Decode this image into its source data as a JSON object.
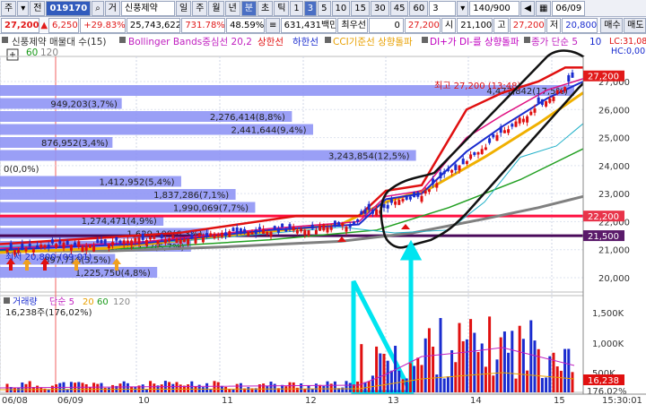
{
  "toolbar": {
    "code_label": "주",
    "market_label": "전",
    "code": "019170",
    "type_label": "거",
    "name": "신풍제약",
    "periods": [
      "일",
      "주",
      "월",
      "년",
      "분",
      "초",
      "틱"
    ],
    "active_period": "분",
    "intervals": [
      "1",
      "3",
      "5",
      "10",
      "15",
      "30",
      "45",
      "60"
    ],
    "active_interval": "1",
    "interval_value": "3",
    "count": "140/900",
    "date": "06/09"
  },
  "quote": {
    "price": "27,200",
    "change": "6,250",
    "change_pct": "+29.83%",
    "volume": "25,743,622",
    "turnover_pct": "731.78%",
    "ratio": "48.59%",
    "amount": "631,431백만",
    "best_quote_label": "최우선",
    "best_quote_value": "0",
    "current": "27,200",
    "open_label": "시",
    "open": "21,100",
    "high_label": "고",
    "high": "27,200",
    "low_label": "저",
    "low": "20,800",
    "buy_label": "매수",
    "sell_label": "매도"
  },
  "legend": {
    "title": "신풍제약 매물대 수(15)",
    "bollinger": "Bollinger Bands중심선 20,2",
    "upper": "상한선",
    "lower": "하한선",
    "cci": "CCI기준선 상향돌파",
    "dmi": "DI+가 DI-를 상향돌파",
    "ma": "종가 단순 5",
    "ma_tail": "10",
    "ma2": "60",
    "ma2_tail": "120",
    "lc_label": "LC:31,08",
    "hc_label": "HC:0,00"
  },
  "price_axis": [
    "27,000",
    "26,000",
    "25,000",
    "24,000",
    "23,000",
    "22,000",
    "21,000",
    "20,000"
  ],
  "price_tags": [
    {
      "text": "27,200",
      "color": "#e11a1a"
    },
    {
      "text": "22,200",
      "color": "#e8344a"
    },
    {
      "text": "21,500",
      "color": "#5a1a6a"
    }
  ],
  "volume_profile": [
    {
      "label": "4,477,842(17,5%)",
      "value": 4477842
    },
    {
      "label": "949,203(3,7%)",
      "value": 949203
    },
    {
      "label": "2,276,414(8,8%)",
      "value": 2276414
    },
    {
      "label": "2,441,644(9,4%)",
      "value": 2441644
    },
    {
      "label": "876,952(3,4%)",
      "value": 876952
    },
    {
      "label": "3,243,854(12,5%)",
      "value": 3243854
    },
    {
      "label": "0(0,0%)",
      "value": 0
    },
    {
      "label": "1,412,952(5,4%)",
      "value": 1412952
    },
    {
      "label": "1,837,286(7,1%)",
      "value": 1837286
    },
    {
      "label": "1,990,069(7,7%)",
      "value": 1990069
    },
    {
      "label": "1,274,471(4,9%)",
      "value": 1274471
    },
    {
      "label": "1,629,109(6,3%)",
      "value": 1629109
    },
    {
      "label": "1,489,127(5,7%)",
      "value": 1489127
    },
    {
      "label": "897,716(3,5%)",
      "value": 897716
    },
    {
      "label": "1,225,750(4,8%)",
      "value": 1225750
    }
  ],
  "annotations": {
    "high": "최고 27,200 (13:48)",
    "low": "최저 20,800 (09:01)"
  },
  "volume_panel": {
    "title": "거래량",
    "ma_label": "단순 5",
    "ma_a": "20",
    "ma_b": "60",
    "ma_c": "120",
    "current": "16,238주(176,02%)",
    "axis": [
      "1,500K",
      "1,000K",
      "500K"
    ],
    "tag_value": "16,238",
    "tag_pct": "176,02%"
  },
  "time_axis": [
    "06/08",
    "06/09",
    "10",
    "11",
    "12",
    "13",
    "14",
    "15"
  ],
  "time_end": "15:30:01",
  "colors": {
    "accent": "#315bbd",
    "up": "#e11a1a",
    "down": "#1a2ccf",
    "profile_bar": "#8f95f5",
    "cyan_mark": "#00e5f0"
  }
}
